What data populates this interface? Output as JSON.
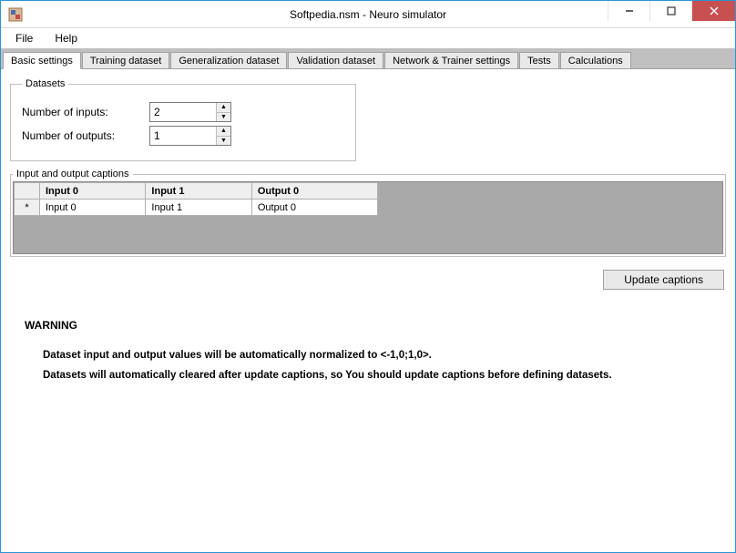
{
  "window": {
    "title": "Softpedia.nsm - Neuro simulator"
  },
  "menu": {
    "file": "File",
    "help": "Help"
  },
  "tabs": {
    "basic": "Basic settings",
    "training": "Training dataset",
    "generalization": "Generalization dataset",
    "validation": "Validation dataset",
    "network": "Network & Trainer settings",
    "tests": "Tests",
    "calculations": "Calculations"
  },
  "datasets": {
    "legend": "Datasets",
    "inputs_label": "Number of inputs:",
    "inputs_value": "2",
    "outputs_label": "Number of outputs:",
    "outputs_value": "1"
  },
  "captions": {
    "legend": "Input and output captions",
    "headers": {
      "h0": "Input 0",
      "h1": "Input 1",
      "h2": "Output 0"
    },
    "row0": {
      "c0": "Input 0",
      "c1": "Input 1",
      "c2": "Output 0"
    },
    "row_marker": "*"
  },
  "buttons": {
    "update_captions": "Update captions"
  },
  "warning": {
    "title": "WARNING",
    "line1": "Dataset input and output values will be automatically normalized to <-1,0;1,0>.",
    "line2": "Datasets will automatically cleared after update captions, so You should update captions before defining datasets."
  }
}
